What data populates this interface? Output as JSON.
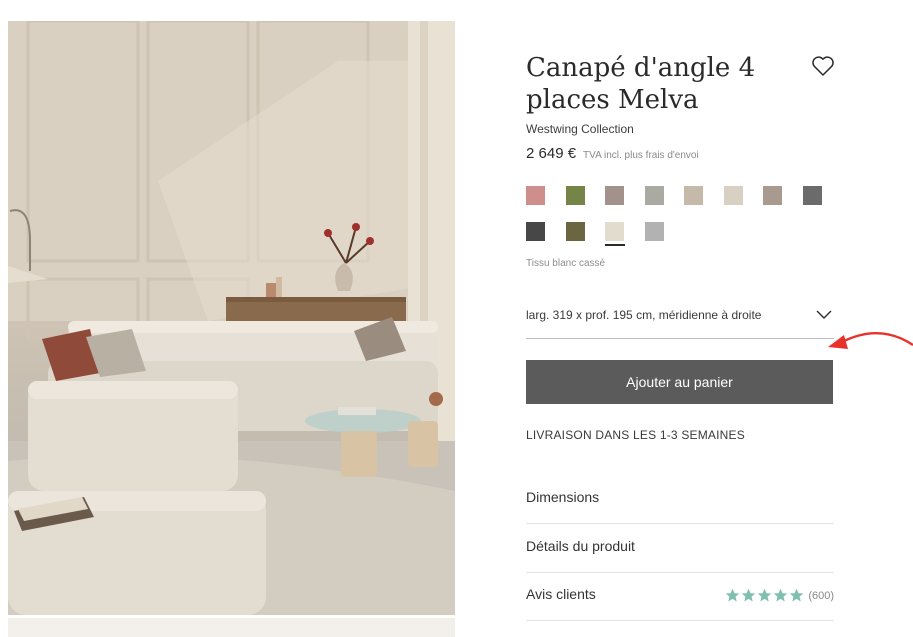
{
  "product": {
    "title": "Canapé d'angle 4 places Melva",
    "brand": "Westwing Collection",
    "price": "2 649 €",
    "vat_note": "TVA incl. plus frais d'envoi",
    "image_alt": "Canapé d'angle Melva dans un salon"
  },
  "wishlist_icon": "heart-outline-icon",
  "colors": {
    "selected_label": "Tissu blanc cassé",
    "selected_index": 10,
    "swatches": [
      "#cd8e8c",
      "#758547",
      "#a3918c",
      "#aaa9a2",
      "#c5b9aa",
      "#d7d0c3",
      "#a89a8f",
      "#6b6b6b",
      "#474747",
      "#6c6542",
      "#e2dccf",
      "#b2b2b2"
    ]
  },
  "dimension_select": {
    "value": "larg. 319 x prof. 195 cm, méridienne à droite"
  },
  "cart_button": {
    "label": "Ajouter au panier",
    "color": "#5b5b5b"
  },
  "delivery": {
    "text": "LIVRAISON DANS LES 1-3 SEMAINES"
  },
  "accordions": [
    {
      "label": "Dimensions"
    },
    {
      "label": "Détails du produit"
    },
    {
      "label": "Avis clients",
      "rating": 5,
      "review_count": "(600)",
      "star_color": "#7fbfae"
    }
  ],
  "annotation": {
    "arrow_color": "#e8312a"
  }
}
